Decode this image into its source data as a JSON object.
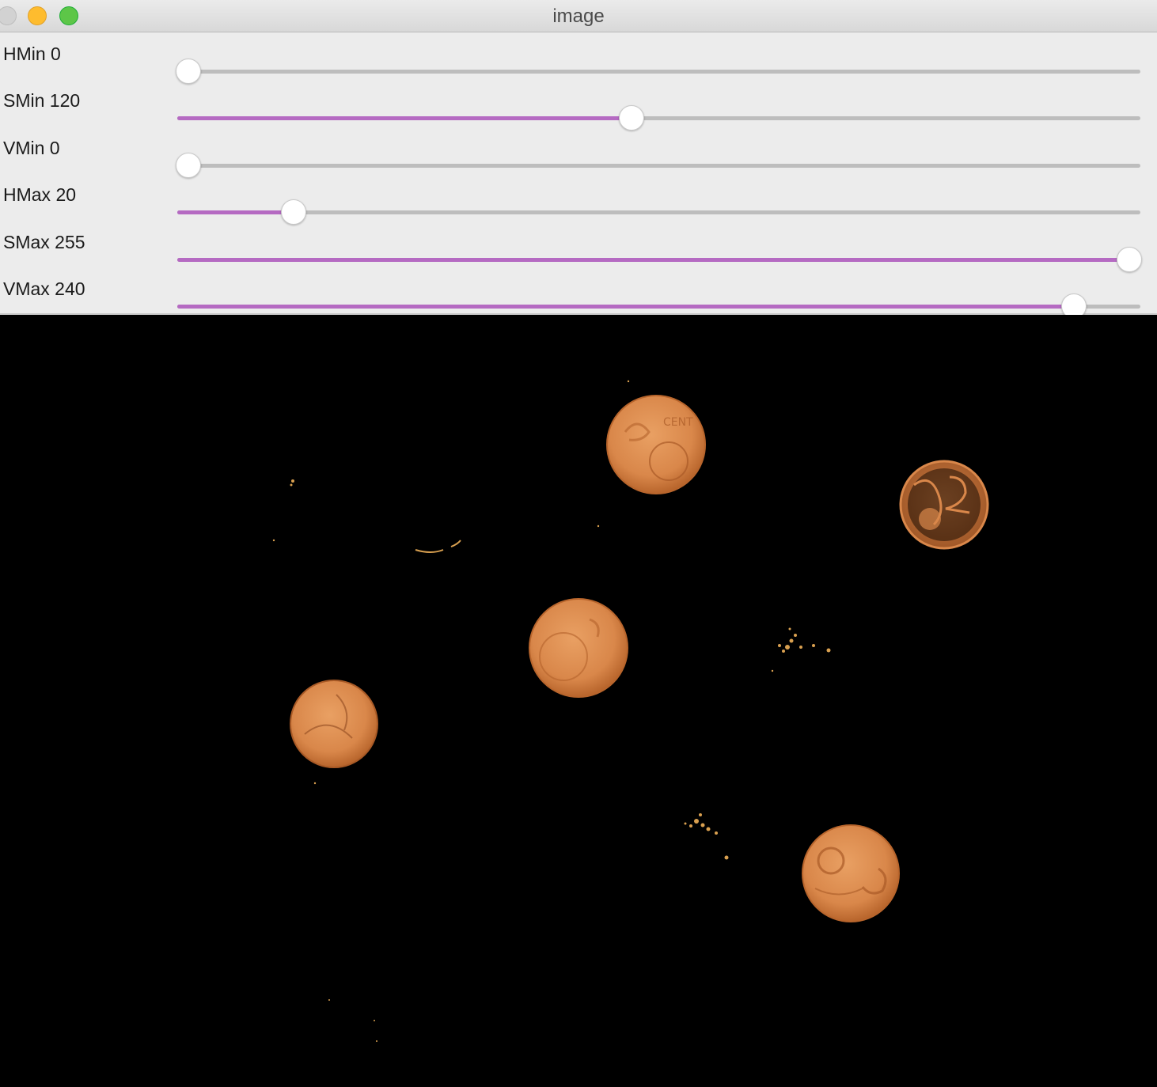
{
  "window": {
    "title": "image",
    "buttons": [
      "close",
      "minimize",
      "zoom"
    ]
  },
  "trackbars": [
    {
      "label": "HMin 0",
      "name": "HMin",
      "value": 0,
      "max": 179
    },
    {
      "label": "SMin 120",
      "name": "SMin",
      "value": 120,
      "max": 255
    },
    {
      "label": "VMin 0",
      "name": "VMin",
      "value": 0,
      "max": 255
    },
    {
      "label": "HMax 20",
      "name": "HMax",
      "value": 20,
      "max": 179
    },
    {
      "label": "SMax 255",
      "name": "SMax",
      "value": 255,
      "max": 255
    },
    {
      "label": "VMax 240",
      "name": "VMax",
      "value": 240,
      "max": 255
    }
  ],
  "colors": {
    "fill": "#b56ac2",
    "track": "#bdbdbd",
    "coin": "#d9874a",
    "coin_edge": "#b8652c",
    "image_background": "#000000"
  },
  "image": {
    "content": "masked-coins"
  }
}
